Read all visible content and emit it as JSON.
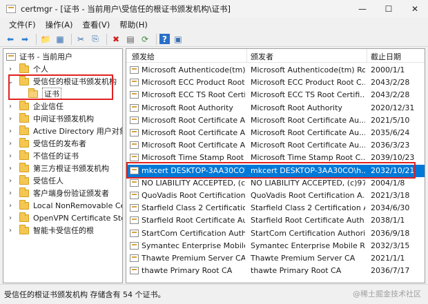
{
  "window": {
    "title": "certmgr - [证书 - 当前用户\\受信任的根证书颁发机构\\证书]",
    "minimize_glyph": "—",
    "maximize_glyph": "☐",
    "close_glyph": "✕"
  },
  "menu": [
    "文件(F)",
    "操作(A)",
    "查看(V)",
    "帮助(H)"
  ],
  "toolbar": {
    "back_glyph": "⬅",
    "forward_glyph": "➡",
    "up_glyph": "📁",
    "show_hide_glyph": "▦",
    "cut_glyph": "✂",
    "copy_glyph": "⎘",
    "delete_glyph": "✖",
    "properties_glyph": "▤",
    "refresh_glyph": "⟳",
    "help_glyph": "?",
    "view_glyph": "▣"
  },
  "tree": {
    "root": "证书 - 当前用户",
    "items": [
      {
        "label": "个人",
        "toggle": "›"
      },
      {
        "label": "受信任的根证书颁发机构",
        "toggle": "⌄"
      },
      {
        "label": "证书",
        "toggle": ""
      },
      {
        "label": "企业信任",
        "toggle": "›"
      },
      {
        "label": "中间证书颁发机构",
        "toggle": "›"
      },
      {
        "label": "Active Directory 用户对象",
        "toggle": "›"
      },
      {
        "label": "受信任的发布者",
        "toggle": "›"
      },
      {
        "label": "不信任的证书",
        "toggle": "›"
      },
      {
        "label": "第三方根证书颁发机构",
        "toggle": "›"
      },
      {
        "label": "受信任人",
        "toggle": "›"
      },
      {
        "label": "客户端身份验证颁发者",
        "toggle": "›"
      },
      {
        "label": "Local NonRemovable Cert",
        "toggle": "›"
      },
      {
        "label": "OpenVPN Certificate Store",
        "toggle": "›"
      },
      {
        "label": "智能卡受信任的根",
        "toggle": "›"
      }
    ]
  },
  "list": {
    "headers": {
      "issued_to": "颁发给",
      "issued_by": "颁发者",
      "expiration": "截止日期"
    },
    "rows": [
      {
        "to": "Microsoft Authenticode(tm) ...",
        "by": "Microsoft Authenticode(tm) Ro...",
        "date": "2000/1/1"
      },
      {
        "to": "Microsoft ECC Product Root ...",
        "by": "Microsoft ECC Product Root C...",
        "date": "2043/2/28"
      },
      {
        "to": "Microsoft ECC TS Root Certif...",
        "by": "Microsoft ECC TS Root Certifi...",
        "date": "2043/2/28"
      },
      {
        "to": "Microsoft Root Authority",
        "by": "Microsoft Root Authority",
        "date": "2020/12/31"
      },
      {
        "to": "Microsoft Root Certificate A...",
        "by": "Microsoft Root Certificate Au...",
        "date": "2021/5/10"
      },
      {
        "to": "Microsoft Root Certificate A...",
        "by": "Microsoft Root Certificate Au...",
        "date": "2035/6/24"
      },
      {
        "to": "Microsoft Root Certificate A...",
        "by": "Microsoft Root Certificate Au...",
        "date": "2036/3/23"
      },
      {
        "to": "Microsoft Time Stamp Root ...",
        "by": "Microsoft Time Stamp Root C...",
        "date": "2039/10/23"
      },
      {
        "to": "mkcert DESKTOP-3AA30CO\\l...",
        "by": "mkcert DESKTOP-3AA30CO\\h...",
        "date": "2032/10/21"
      },
      {
        "to": "NO LIABILITY ACCEPTED, (c)...",
        "by": "NO LIABILITY ACCEPTED, (c)97...",
        "date": "2004/1/8"
      },
      {
        "to": "QuoVadis Root Certification ...",
        "by": "QuoVadis Root Certification A...",
        "date": "2021/3/18"
      },
      {
        "to": "Starfield Class 2 Certificatio...",
        "by": "Starfield Class 2 Certification A...",
        "date": "2034/6/30"
      },
      {
        "to": "Starfield Root Certificate Aut...",
        "by": "Starfield Root Certificate Auth...",
        "date": "2038/1/1"
      },
      {
        "to": "StartCom Certification Autho...",
        "by": "StartCom Certification Authority",
        "date": "2036/9/18"
      },
      {
        "to": "Symantec Enterprise Mobile ...",
        "by": "Symantec Enterprise Mobile R...",
        "date": "2032/3/15"
      },
      {
        "to": "Thawte Premium Server CA",
        "by": "Thawte Premium Server CA",
        "date": "2021/1/1"
      },
      {
        "to": "thawte Primary Root CA",
        "by": "thawte Primary Root CA",
        "date": "2036/7/17"
      }
    ]
  },
  "status": "受信任的根证书颁发机构 存储含有 54 个证书。",
  "watermark": "@稀土掘金技术社区",
  "colors": {
    "highlight": "#e02020",
    "selection": "#0078d7"
  }
}
